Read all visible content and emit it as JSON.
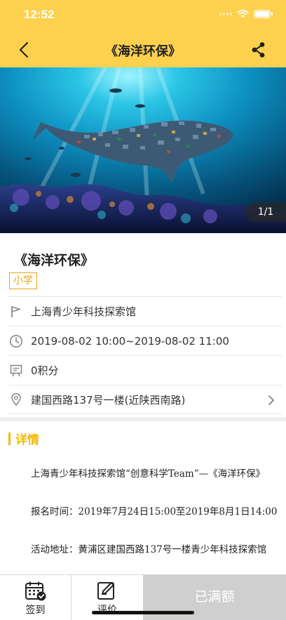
{
  "status": {
    "time": "12:52"
  },
  "nav": {
    "title": "《海洋环保》"
  },
  "hero": {
    "counter": "1/1"
  },
  "event": {
    "title": "《海洋环保》",
    "tag": "小学",
    "venue": "上海青少年科技探索馆",
    "time_range": "2019-08-02 10:00~2019-08-02 11:00",
    "points": "0积分",
    "address": "建国西路137号一楼(近陕西南路)"
  },
  "detail": {
    "heading": "详情",
    "paragraphs": [
      "上海青少年科技探索馆“创意科学Team”—《海洋环保》",
      "报名时间：2019年7月24日15:00至2019年8月1日14:00",
      "活动地址：黄浦区建国西路137号一楼青少年科技探索馆"
    ]
  },
  "bottom": {
    "checkin_label": "签到",
    "review_label": "评价",
    "status_button": "已满额"
  },
  "colors": {
    "accent": "#FDD14E",
    "detail_accent": "#F5B800",
    "tag": "#E8A317"
  }
}
